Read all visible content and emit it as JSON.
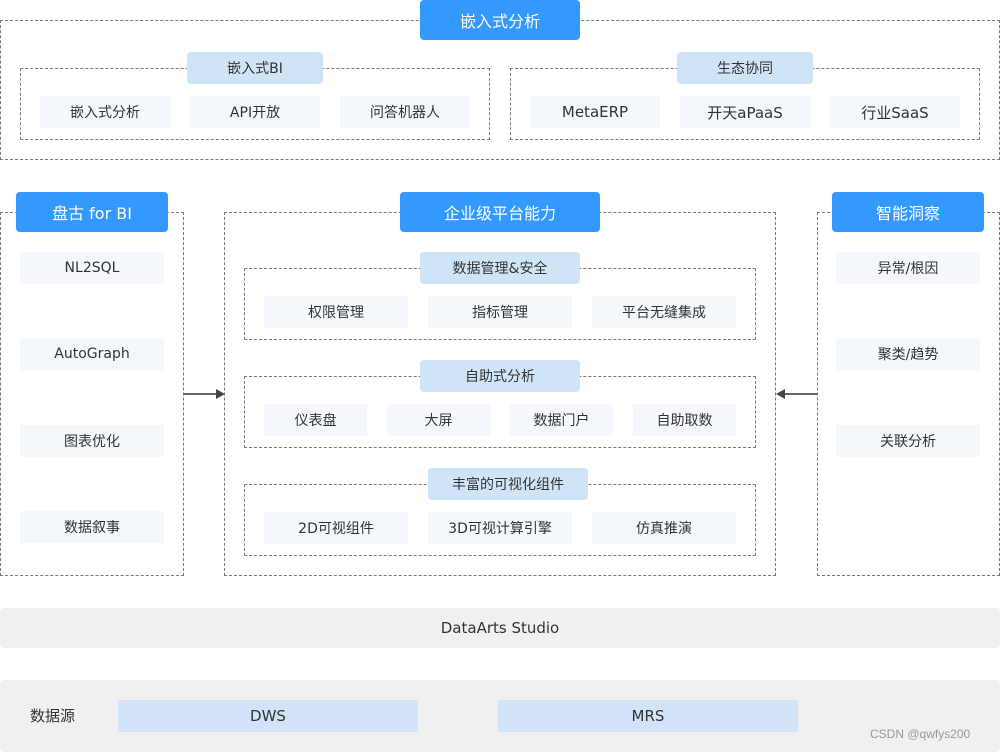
{
  "top": {
    "title": "嵌入式分析",
    "groups": [
      {
        "title": "嵌入式BI",
        "items": [
          "嵌入式分析",
          "API开放",
          "问答机器人"
        ]
      },
      {
        "title": "生态协同",
        "items": [
          "MetaERP",
          "开天aPaaS",
          "行业SaaS"
        ]
      }
    ]
  },
  "left": {
    "title": "盘古 for BI",
    "items": [
      "NL2SQL",
      "AutoGraph",
      "图表优化",
      "数据叙事"
    ]
  },
  "center": {
    "title": "企业级平台能力",
    "groups": [
      {
        "title": "数据管理&安全",
        "items": [
          "权限管理",
          "指标管理",
          "平台无缝集成"
        ]
      },
      {
        "title": "自助式分析",
        "items": [
          "仪表盘",
          "大屏",
          "数据门户",
          "自助取数"
        ]
      },
      {
        "title": "丰富的可视化组件",
        "items": [
          "2D可视组件",
          "3D可视计算引擎",
          "仿真推演"
        ]
      }
    ]
  },
  "right": {
    "title": "智能洞察",
    "items": [
      "异常/根因",
      "聚类/趋势",
      "关联分析"
    ]
  },
  "studio": {
    "label": "DataArts Studio"
  },
  "datasource": {
    "label": "数据源",
    "items": [
      "DWS",
      "MRS"
    ]
  },
  "watermark": "CSDN @qwfys200",
  "colors": {
    "accent": "#3399ff",
    "subtitle_bg": "#d0e4f8",
    "item_bg": "#f4f8fd",
    "bar_bg": "#f0f0f0",
    "datasource_item_bg": "#d2e3f8"
  }
}
